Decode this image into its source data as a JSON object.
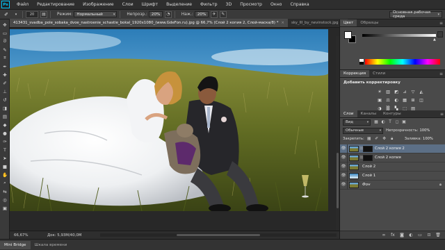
{
  "app": {
    "logo": "Ps"
  },
  "menu": [
    "Файл",
    "Редактирование",
    "Изображение",
    "Слои",
    "Шрифт",
    "Выделение",
    "Фильтр",
    "3D",
    "Просмотр",
    "Окно",
    "Справка"
  ],
  "options": {
    "brush_size": "20",
    "mode_label": "Режим:",
    "mode_value": "Нормальный",
    "opacity_label": "Непрозр.:",
    "opacity_value": "20%",
    "pressure_label": "Наж.:",
    "pressure_value": "20%",
    "workspace": "Основная рабочая среда"
  },
  "tools": [
    {
      "icon": "move-tool-icon",
      "glyph": "✥"
    },
    {
      "icon": "marquee-tool-icon",
      "glyph": "▭"
    },
    {
      "icon": "lasso-tool-icon",
      "glyph": "ᘐ"
    },
    {
      "icon": "quick-select-tool-icon",
      "glyph": "✎"
    },
    {
      "icon": "crop-tool-icon",
      "glyph": "⌗"
    },
    {
      "icon": "eyedropper-tool-icon",
      "glyph": "✒"
    },
    {
      "icon": "healing-tool-icon",
      "glyph": "✚"
    },
    {
      "icon": "brush-tool-icon",
      "glyph": "✐"
    },
    {
      "icon": "clone-stamp-tool-icon",
      "glyph": "⊥"
    },
    {
      "icon": "history-brush-tool-icon",
      "glyph": "↺"
    },
    {
      "icon": "eraser-tool-icon",
      "glyph": "◨"
    },
    {
      "icon": "gradient-tool-icon",
      "glyph": "▤"
    },
    {
      "icon": "blur-tool-icon",
      "glyph": "◆"
    },
    {
      "icon": "dodge-tool-icon",
      "glyph": "●"
    },
    {
      "icon": "pen-tool-icon",
      "glyph": "✑"
    },
    {
      "icon": "type-tool-icon",
      "glyph": "T"
    },
    {
      "icon": "path-select-tool-icon",
      "glyph": "➤"
    },
    {
      "icon": "shape-tool-icon",
      "glyph": "■"
    },
    {
      "icon": "hand-tool-icon",
      "glyph": "✋"
    },
    {
      "icon": "zoom-tool-icon",
      "glyph": "⌕"
    },
    {
      "icon": "swap-colors-icon",
      "glyph": "⇆"
    },
    {
      "icon": "quick-mask-icon",
      "glyph": "◎"
    },
    {
      "icon": "screen-mode-icon",
      "glyph": "▣"
    }
  ],
  "document": {
    "tabs": [
      {
        "label": "413431_svadba_pole_sobaka_dvoe_nastroenie_schastie_bokal_1920x1080_(www.GdeFon.ru).jpg @ 66,7% (Слой 2 копия 2, Слой-маска/8) *",
        "active": true
      },
      {
        "label": "sky_III_by_nevinstock.jpg",
        "active": false
      }
    ],
    "zoom": "66,67%",
    "doc_size": "Док: 5,93M/40,0M"
  },
  "panels": {
    "color": {
      "tabs": [
        "Цвет",
        "Образцы"
      ]
    },
    "adjustments": {
      "tabs": [
        "Коррекция",
        "Стили"
      ],
      "title": "Добавить корректировку",
      "row1": [
        "☀",
        "▥",
        "◩",
        "⊿",
        "▽",
        "◭"
      ],
      "row2": [
        "▣",
        "⚖",
        "◐",
        "▦",
        "⊞",
        "◫"
      ],
      "row3": [
        "◑",
        "▒",
        "▚",
        "⬚",
        "▤"
      ]
    },
    "layers": {
      "tabs": [
        "Слои",
        "Каналы",
        "Контуры"
      ],
      "kind": "Вид",
      "blend": "Обычные",
      "opacity_label": "Непрозрачность:",
      "opacity_value": "100%",
      "lock_label": "Закрепить:",
      "fill_label": "Заливка:",
      "fill_value": "100%",
      "items": [
        {
          "name": "Слой 2 копия 2",
          "selected": true,
          "thumb": "photo",
          "mask": "dark",
          "locked": false
        },
        {
          "name": "Слой 2 копия",
          "selected": false,
          "thumb": "photo",
          "mask": "dark",
          "locked": false
        },
        {
          "name": "Слой 2",
          "selected": false,
          "thumb": "photo",
          "mask": "none",
          "locked": false
        },
        {
          "name": "Слой 1",
          "selected": false,
          "thumb": "sky",
          "mask": "none",
          "locked": false
        },
        {
          "name": "Фон",
          "selected": false,
          "thumb": "photo",
          "mask": "none",
          "locked": true,
          "italic": true
        }
      ]
    }
  },
  "bottom_tabs": [
    {
      "label": "Mini Bridge",
      "active": true
    },
    {
      "label": "Шкала времени",
      "active": false
    }
  ],
  "colors": {
    "selection": "#5c6f86",
    "panel_bg": "#4a4a4a",
    "accent_logo": "#00c8ff"
  }
}
